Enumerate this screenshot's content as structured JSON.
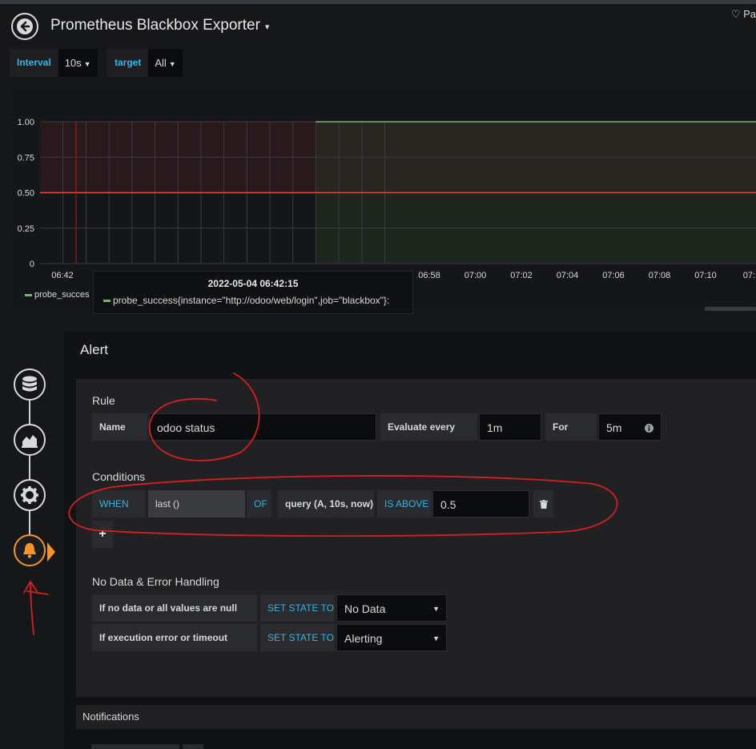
{
  "header": {
    "title": "Prometheus Blackbox Exporter",
    "variables": [
      {
        "label": "Interval",
        "value": "10s"
      },
      {
        "label": "target",
        "value": "All"
      }
    ]
  },
  "panel": {
    "badge": "Pa",
    "legend": "probe_succes",
    "tooltip": {
      "time": "2022-05-04 06:42:15",
      "series": "probe_success{instance=\"http://odoo/web/login\",job=\"blackbox\"}:"
    }
  },
  "chart_data": {
    "type": "line",
    "series": [
      {
        "name": "probe_success{instance=\"http://odoo/web/login\",job=\"blackbox\"}",
        "points": [
          [
            "06:54",
            1
          ],
          [
            "07:12",
            1
          ]
        ]
      }
    ],
    "x_tick_labels": [
      "06:42",
      "06:58",
      "07:00",
      "07:02",
      "07:04",
      "07:06",
      "07:08",
      "07:10",
      "07:1"
    ],
    "y_tick_labels": [
      "1.00",
      "0.75",
      "0.50",
      "0.25",
      "0"
    ],
    "ylim": [
      0,
      1
    ],
    "threshold": 0.5,
    "colors": {
      "series": "#7eb26d",
      "threshold": "#e24d42",
      "alert_region": "#3b1e1f",
      "ok_region": "#1e2a1d"
    }
  },
  "alert": {
    "title": "Alert",
    "rule": {
      "section": "Rule",
      "name_label": "Name",
      "name_value": "odoo status",
      "evaluate_label": "Evaluate every",
      "evaluate_value": "1m",
      "for_label": "For",
      "for_value": "5m"
    },
    "conditions": {
      "section": "Conditions",
      "when": "WHEN",
      "reducer": "last ()",
      "of": "OF",
      "query": "query (A, 10s, now)",
      "evaluator": "IS ABOVE",
      "threshold": "0.5",
      "add": "+"
    },
    "nodata": {
      "section": "No Data & Error Handling",
      "rows": [
        {
          "label": "If no data or all values are null",
          "set": "SET STATE TO",
          "value": "No Data"
        },
        {
          "label": "If execution error or timeout",
          "set": "SET STATE TO",
          "value": "Alerting"
        }
      ]
    }
  },
  "notifications": {
    "title": "Notifications"
  },
  "icons": [
    "back-arrow-icon",
    "caret-down-icon",
    "heart-icon",
    "database-icon",
    "area-chart-icon",
    "gear-icon",
    "bell-icon",
    "info-icon",
    "trash-icon"
  ],
  "accent": {
    "blue": "#33b5e5",
    "orange": "#f79520",
    "annotation": "#d42020"
  }
}
